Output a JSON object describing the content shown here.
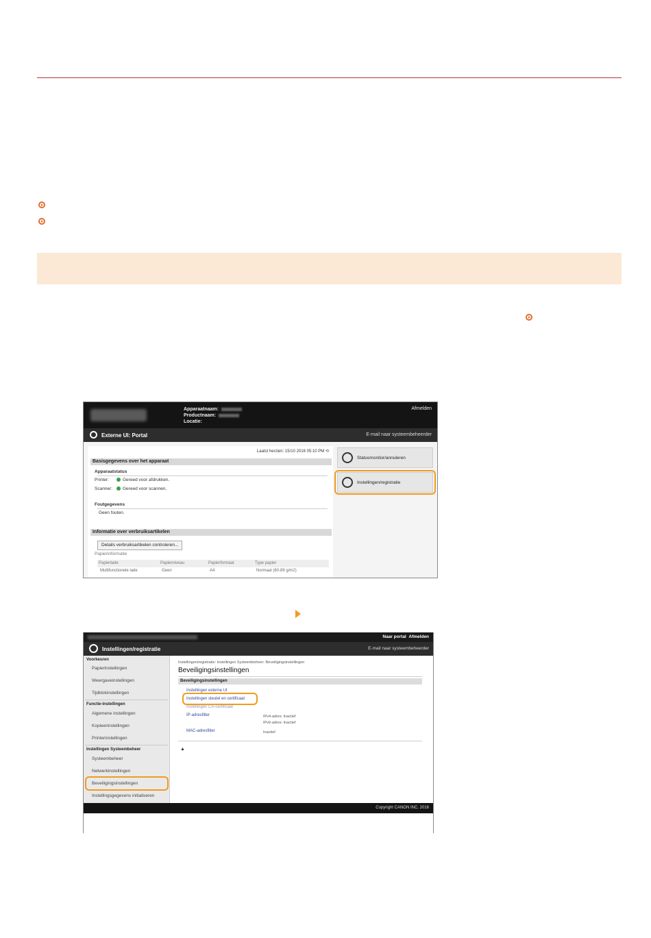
{
  "screenshot1": {
    "header": {
      "device_name_label": "Apparaatnaam:",
      "product_name_label": "Productnaam:",
      "location_label": "Locatie:",
      "logout": "Afmelden"
    },
    "title_bar": {
      "title": "Externe UI: Portal",
      "mail_admin": "E-mail naar systeembeheerder"
    },
    "last_updated": "Laatst herzien: 15/10 2016 05:10 PM",
    "basic_info": {
      "section_title": "Basisgegevens over het apparaat",
      "device_status_label": "Apparaatstatus",
      "printer_label": "Printer:",
      "printer_status": "Gereed voor afdrukken.",
      "scanner_label": "Scanner:",
      "scanner_status": "Gereed voor scannen."
    },
    "error_info": {
      "title": "Foutgegevens",
      "text": "Geen fouten."
    },
    "consumables": {
      "section_title": "Informatie over verbruiksartikelen",
      "check_button": "Details verbruiksartikelen controleren...",
      "paper_info_title": "Papierinformatie",
      "columns": [
        "Papierlade",
        "Papierniveau",
        "Papierformaat",
        "Type papier"
      ],
      "rows": [
        [
          "Multifunctionele lade",
          "Geen",
          "A4",
          "Normaal (60-89 g/m2)"
        ]
      ]
    },
    "right_buttons": {
      "status_monitor": "Statusmonitor/annuleren",
      "settings": "Instellingen/registratie"
    }
  },
  "screenshot2": {
    "header": {
      "portal_link": "Naar portal",
      "logout": "Afmelden"
    },
    "title_bar": {
      "title": "Instellingen/registratie",
      "mail_admin": "E-mail naar systeembeheerder"
    },
    "sidebar": {
      "cat_preferences": "Voorkeuren",
      "paper_settings": "Papierinstellingen",
      "display_settings": "Weergaveinstellingen",
      "timer_settings": "Tijdklokinstellingen",
      "cat_function": "Functie-instellingen",
      "general_settings": "Algemene instellingen",
      "copy_settings": "Kopieerinstellingen",
      "printer_settings": "Printerinstellingen",
      "cat_system": "Instellingen Systeembeheer",
      "system_management": "Systeembeheer",
      "network_settings": "Netwerkinstellingen",
      "security_settings": "Beveiligingsinstellingen",
      "init_settings": "Instellingsgegevens initialiseren"
    },
    "main": {
      "breadcrumb": "Instellingen/registratie: Instellingen Systeembeheer: Beveiligingsinstellingen",
      "heading": "Beveiligingsinstellingen",
      "section_title": "Beveiligingsinstellingen",
      "remote_ui": "Instellingen externe UI",
      "key_cert": "Instellingen sleutel en certificaat",
      "ca_cert": "Instellingen CA-certificaat",
      "ip_filter": "IP-adresfilter",
      "ipv4": "IPv4-adres: Inactief",
      "ipv6": "IPv6-adres: Inactief",
      "mac_filter": "MAC-adresfilter",
      "mac_value": "Inactief"
    },
    "footer": "Copyright CANON INC. 2016"
  }
}
